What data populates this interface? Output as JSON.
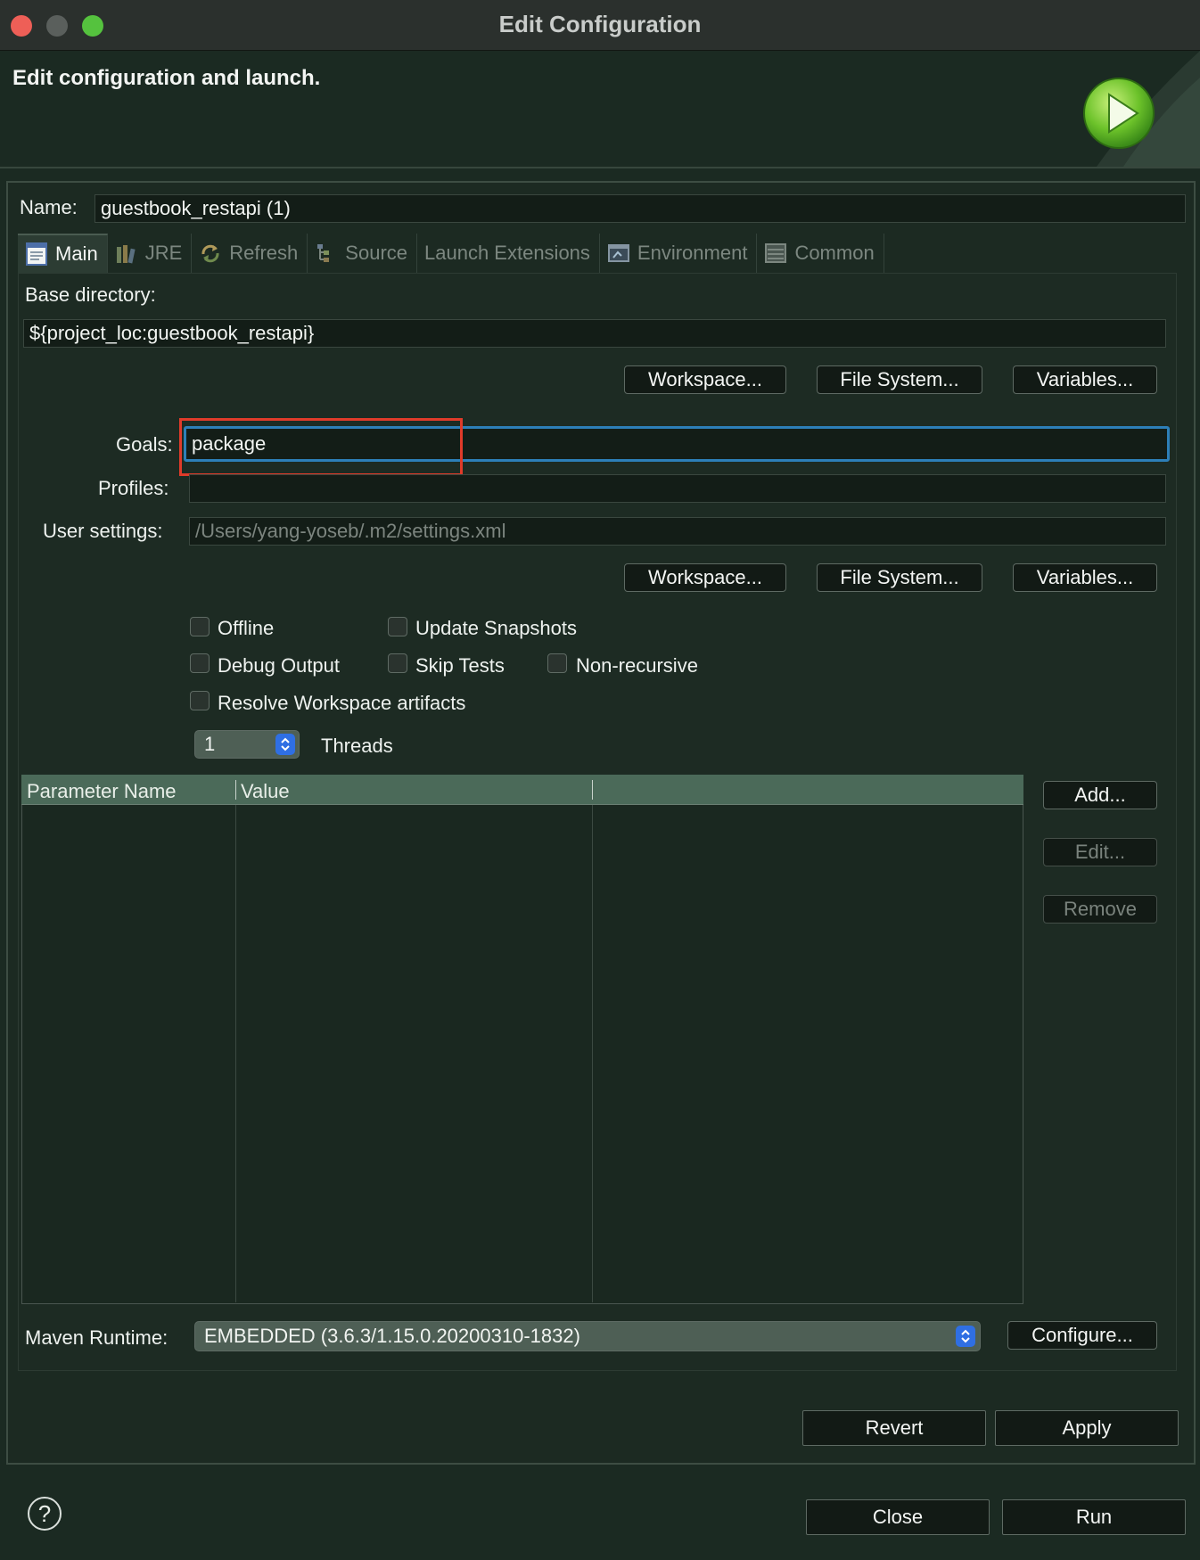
{
  "window": {
    "title": "Edit Configuration"
  },
  "banner": {
    "message": "Edit configuration and launch."
  },
  "name_field": {
    "label": "Name:",
    "value": "guestbook_restapi (1)"
  },
  "tabs": [
    {
      "label": "Main",
      "icon": "main-tab-icon",
      "active": true
    },
    {
      "label": "JRE",
      "icon": "jre-icon",
      "active": false
    },
    {
      "label": "Refresh",
      "icon": "refresh-icon",
      "active": false
    },
    {
      "label": "Source",
      "icon": "source-icon",
      "active": false
    },
    {
      "label": "Launch Extensions",
      "icon": "",
      "active": false
    },
    {
      "label": "Environment",
      "icon": "environment-icon",
      "active": false
    },
    {
      "label": "Common",
      "icon": "common-icon",
      "active": false
    }
  ],
  "main": {
    "base_dir_label": "Base directory:",
    "base_dir_value": "${project_loc:guestbook_restapi}",
    "dir_buttons": {
      "workspace": "Workspace...",
      "filesystem": "File System...",
      "variables": "Variables..."
    },
    "goals_label": "Goals:",
    "goals_value": "package",
    "profiles_label": "Profiles:",
    "profiles_value": "",
    "user_settings_label": "User settings:",
    "user_settings_placeholder": "/Users/yang-yoseb/.m2/settings.xml",
    "settings_buttons": {
      "workspace": "Workspace...",
      "filesystem": "File System...",
      "variables": "Variables..."
    },
    "checkboxes": {
      "offline": "Offline",
      "update_snapshots": "Update Snapshots",
      "debug_output": "Debug Output",
      "skip_tests": "Skip Tests",
      "non_recursive": "Non-recursive",
      "resolve_workspace": "Resolve Workspace artifacts"
    },
    "threads_value": "1",
    "threads_label": "Threads",
    "params_table": {
      "columns": [
        "Parameter Name",
        "Value"
      ],
      "rows": []
    },
    "param_buttons": {
      "add": "Add...",
      "edit": "Edit...",
      "remove": "Remove"
    },
    "runtime_label": "Maven Runtime:",
    "runtime_value": "EMBEDDED (3.6.3/1.15.0.20200310-1832)",
    "configure_button": "Configure..."
  },
  "actions": {
    "revert": "Revert",
    "apply": "Apply",
    "close": "Close",
    "run": "Run",
    "help": "?"
  },
  "colors": {
    "background": "#1b2a22",
    "focus_border": "#2d7fb8",
    "highlight": "#e03b2a",
    "table_header": "#4b6a59"
  }
}
